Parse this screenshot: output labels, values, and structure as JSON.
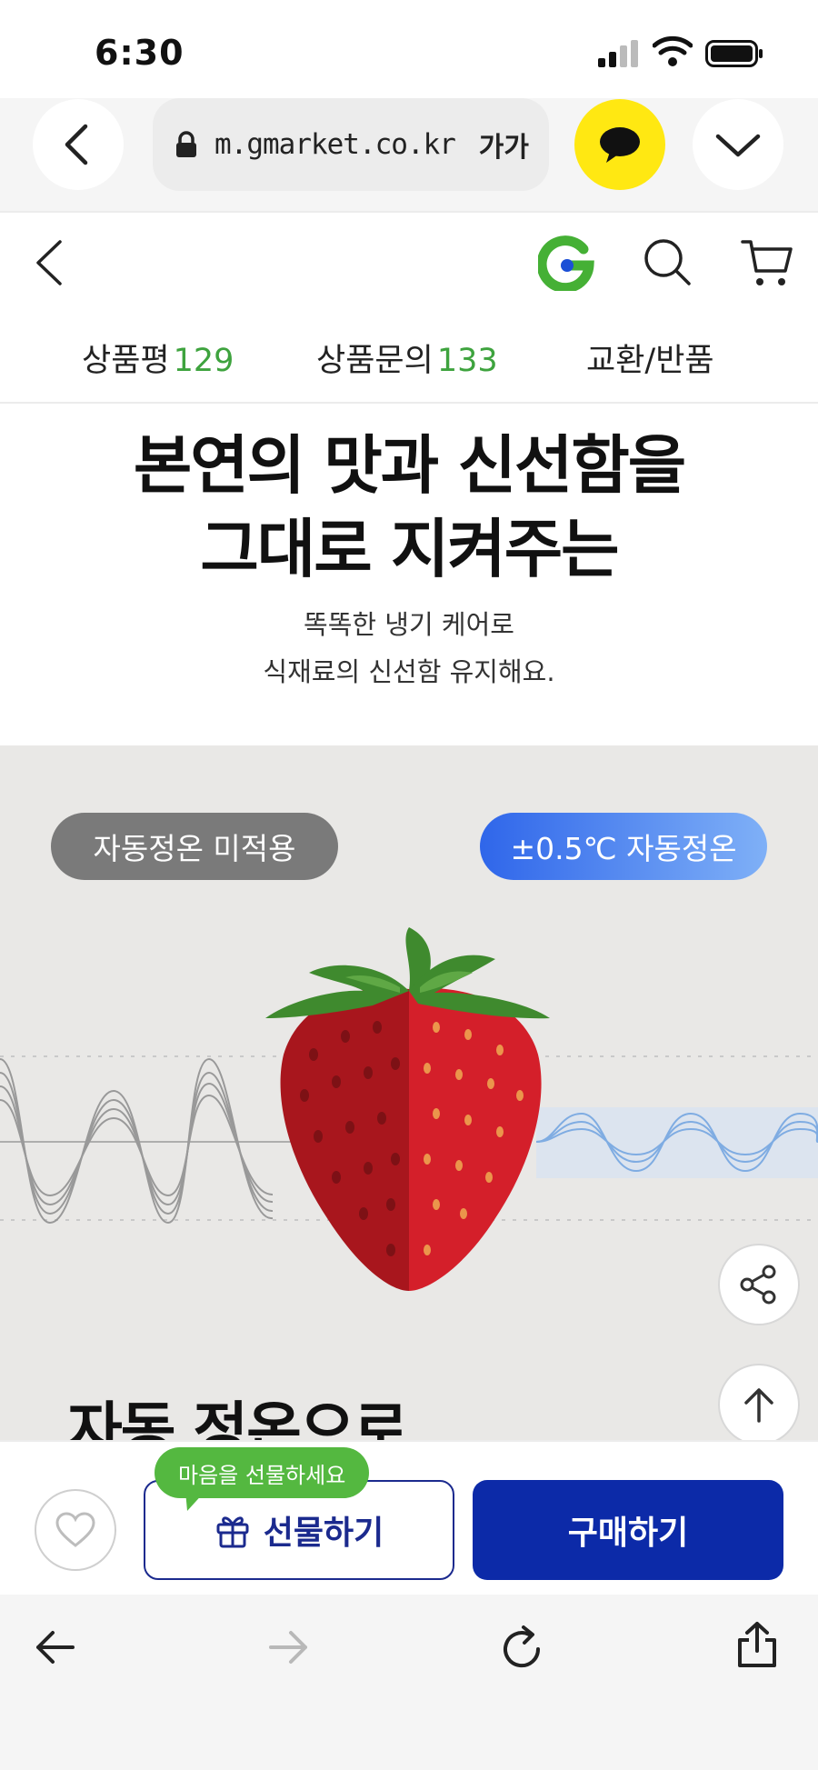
{
  "status_bar": {
    "time": "6:30"
  },
  "browser": {
    "url": "m.gmarket.co.kr",
    "text_size_label": "가가"
  },
  "tabs": [
    {
      "label": "상품평",
      "count": "129"
    },
    {
      "label": "상품문의",
      "count": "133"
    },
    {
      "label": "교환/반품",
      "count": ""
    }
  ],
  "hero": {
    "headline_line1": "본연의 맛과 신선함을",
    "headline_line2": "그대로 지켜주는",
    "sub_line1": "똑똑한 냉기 케어로",
    "sub_line2": "식재료의 신선함 유지해요."
  },
  "compare": {
    "left_badge": "자동정온 미적용",
    "right_badge": "±0.5℃ 자동정온",
    "title": "자동 정온으로"
  },
  "purchase": {
    "tooltip": "마음을 선물하세요",
    "gift_label": "선물하기",
    "buy_label": "구매하기"
  },
  "colors": {
    "accent_green": "#3ea33e",
    "brand_blue": "#0c2aa8",
    "kakao_yellow": "#ffe812",
    "badge_blue": "#2f66ea"
  },
  "icons": [
    "back-icon",
    "lock-icon",
    "talk-icon",
    "chevron-down-icon",
    "gmarket-logo-icon",
    "search-icon",
    "cart-icon",
    "share-icon",
    "arrow-up-icon",
    "heart-icon",
    "gift-icon",
    "arrow-left-icon",
    "arrow-right-icon",
    "reload-icon",
    "share-upload-icon"
  ]
}
